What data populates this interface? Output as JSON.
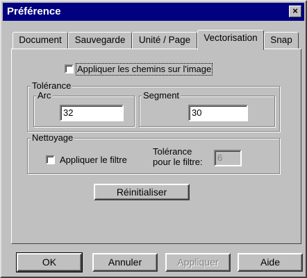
{
  "window": {
    "title": "Préférence",
    "close_glyph": "×"
  },
  "tabs": [
    {
      "label": "Document",
      "active": false
    },
    {
      "label": "Sauvegarde",
      "active": false
    },
    {
      "label": "Unité / Page",
      "active": false
    },
    {
      "label": "Vectorisation",
      "active": true
    },
    {
      "label": "Snap",
      "active": false
    }
  ],
  "vectorisation": {
    "apply_paths": {
      "label": "Appliquer les chemins sur l'image",
      "checked": false
    },
    "tolerance": {
      "legend": "Tolérance",
      "arc": {
        "legend": "Arc",
        "value": "32"
      },
      "segment": {
        "legend": "Segment",
        "value": "30"
      }
    },
    "nettoyage": {
      "legend": "Nettoyage",
      "apply_filter": {
        "label": "Appliquer le filtre",
        "checked": false
      },
      "filter_tolerance_label_1": "Tolérance",
      "filter_tolerance_label_2": "pour le filtre:",
      "filter_tolerance_value": "6"
    },
    "reset_label": "Réinitialiser"
  },
  "footer": {
    "ok_label": "OK",
    "cancel_label": "Annuler",
    "apply_label": "Appliquer",
    "help_label": "Aide"
  }
}
